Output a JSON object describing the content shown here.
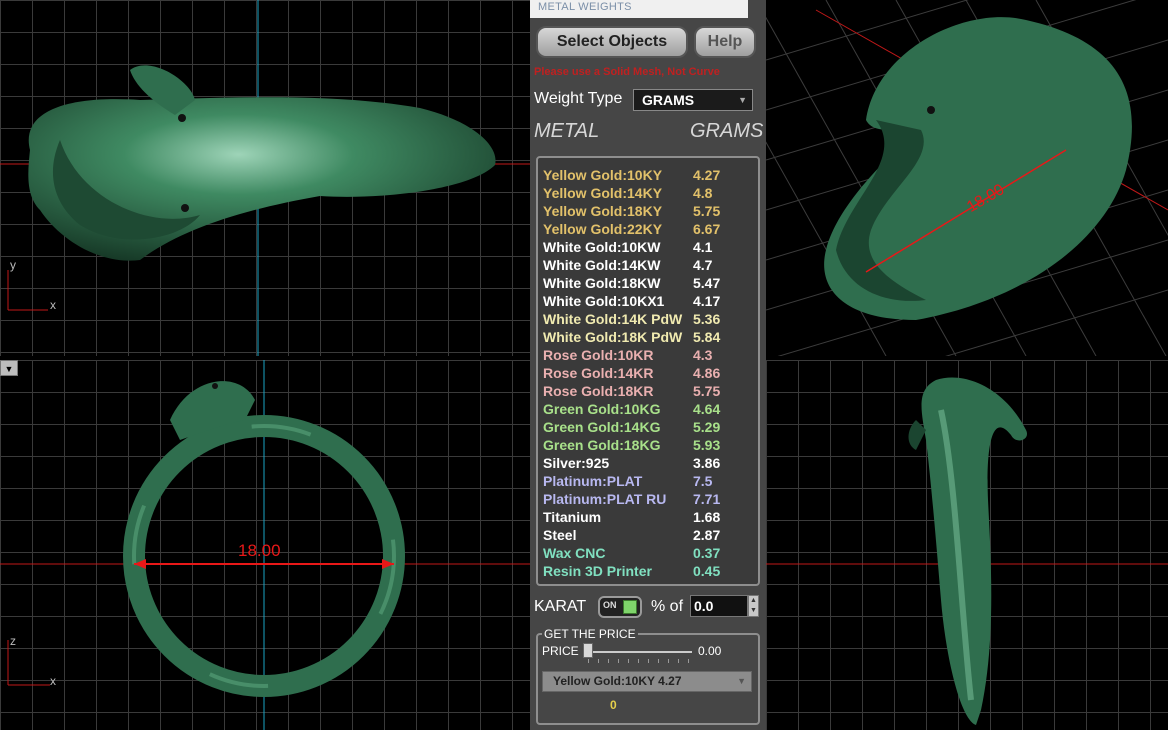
{
  "panel": {
    "title": "METAL WEIGHTS",
    "select_objects_label": "Select Objects",
    "help_label": "Help",
    "warning": "Please use a Solid Mesh, Not Curve",
    "weight_type_label": "Weight Type",
    "weight_type_value": "GRAMS",
    "header_metal": "METAL",
    "header_grams": "GRAMS",
    "metals": [
      {
        "name": "Yellow Gold:10KY",
        "grams": "4.27",
        "color": "#e2c16a"
      },
      {
        "name": "Yellow Gold:14KY",
        "grams": "4.8",
        "color": "#e2c16a"
      },
      {
        "name": "Yellow Gold:18KY",
        "grams": "5.75",
        "color": "#e2c16a"
      },
      {
        "name": "Yellow Gold:22KY",
        "grams": "6.67",
        "color": "#e2c16a"
      },
      {
        "name": "White Gold:10KW",
        "grams": "4.1",
        "color": "#ffffff"
      },
      {
        "name": "White Gold:14KW",
        "grams": "4.7",
        "color": "#ffffff"
      },
      {
        "name": "White Gold:18KW",
        "grams": "5.47",
        "color": "#ffffff"
      },
      {
        "name": "White Gold:10KX1",
        "grams": "4.17",
        "color": "#ffffff"
      },
      {
        "name": "White Gold:14K PdW",
        "grams": "5.36",
        "color": "#f0eab0"
      },
      {
        "name": "White Gold:18K PdW",
        "grams": "5.84",
        "color": "#f0eab0"
      },
      {
        "name": "Rose Gold:10KR",
        "grams": "4.3",
        "color": "#eab0b0"
      },
      {
        "name": "Rose Gold:14KR",
        "grams": "4.86",
        "color": "#eab0b0"
      },
      {
        "name": "Rose Gold:18KR",
        "grams": "5.75",
        "color": "#eab0b0"
      },
      {
        "name": "Green Gold:10KG",
        "grams": "4.64",
        "color": "#a8e08a"
      },
      {
        "name": "Green Gold:14KG",
        "grams": "5.29",
        "color": "#a8e08a"
      },
      {
        "name": "Green Gold:18KG",
        "grams": "5.93",
        "color": "#a8e08a"
      },
      {
        "name": "Silver:925",
        "grams": "3.86",
        "color": "#ffffff"
      },
      {
        "name": "Platinum:PLAT",
        "grams": "7.5",
        "color": "#b8b8f0"
      },
      {
        "name": "Platinum:PLAT RU",
        "grams": "7.71",
        "color": "#b8b8f0"
      },
      {
        "name": "Titanium",
        "grams": "1.68",
        "color": "#ffffff"
      },
      {
        "name": "Steel",
        "grams": "2.87",
        "color": "#ffffff"
      },
      {
        "name": "Wax  CNC",
        "grams": "0.37",
        "color": "#80e0c0"
      },
      {
        "name": "Resin 3D Printer",
        "grams": "0.45",
        "color": "#80e0c0"
      }
    ],
    "karat_label": "KARAT",
    "karat_toggle": "ON",
    "percent_label": "% of",
    "percent_value": "0.0",
    "price_group_title": "GET THE PRICE",
    "price_label": "PRICE",
    "price_slider_value": 0,
    "price_value": "0.00",
    "price_metal_selected": "Yellow Gold:10KY 4.27",
    "price_result": "0"
  },
  "viewports": {
    "top_axis_y": "y",
    "top_axis_x": "x",
    "front_axis_z": "z",
    "front_axis_x": "x",
    "dimension": "18.00",
    "persp_dimension": "18.00"
  },
  "colors": {
    "ring_green": "#2f6e4e",
    "dimension_red": "#e81818",
    "grid": "#3a3a3a",
    "panel_bg": "#464646"
  }
}
